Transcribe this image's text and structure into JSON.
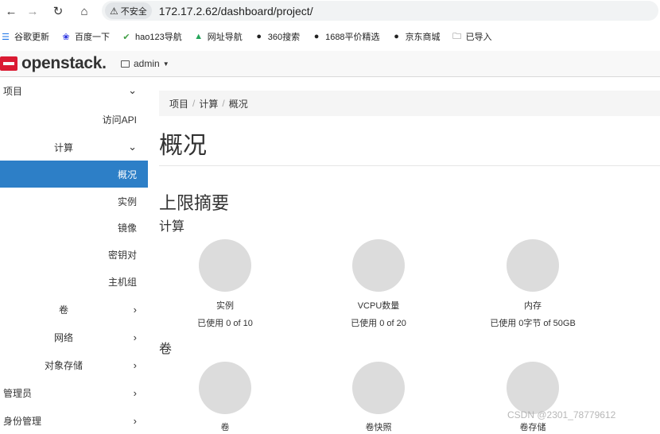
{
  "browser": {
    "security_label": "不安全",
    "url": "172.17.2.62/dashboard/project/",
    "bookmarks": [
      {
        "label": "谷歌更新",
        "icon": "wifi-icon"
      },
      {
        "label": "百度一下",
        "icon": "baidu-icon"
      },
      {
        "label": "hao123导航",
        "icon": "hao123-icon"
      },
      {
        "label": "网址导航",
        "icon": "nav-site-icon"
      },
      {
        "label": "360搜索",
        "icon": "globe-icon"
      },
      {
        "label": "1688平价精选",
        "icon": "globe-icon"
      },
      {
        "label": "京东商城",
        "icon": "globe-icon"
      },
      {
        "label": "已导入",
        "icon": "folder-icon"
      }
    ]
  },
  "header": {
    "logo": "openstack.",
    "project": "admin"
  },
  "sidebar": {
    "items": [
      {
        "label": "项目"
      },
      {
        "label": "访问API"
      },
      {
        "label": "计算"
      },
      {
        "label": "概况"
      },
      {
        "label": "实例"
      },
      {
        "label": "镜像"
      },
      {
        "label": "密钥对"
      },
      {
        "label": "主机组"
      },
      {
        "label": "卷"
      },
      {
        "label": "网络"
      },
      {
        "label": "对象存储"
      },
      {
        "label": "管理员"
      },
      {
        "label": "身份管理"
      }
    ]
  },
  "breadcrumb": [
    "项目",
    "计算",
    "概况"
  ],
  "page_title": "概况",
  "limits": {
    "heading": "上限摘要",
    "compute": {
      "heading": "计算",
      "charts": [
        {
          "label": "实例",
          "usage": "已使用 0 of 10",
          "used": 0,
          "total": 10
        },
        {
          "label": "VCPU数量",
          "usage": "已使用 0 of 20",
          "used": 0,
          "total": 20
        },
        {
          "label": "内存",
          "usage": "已使用 0字节 of 50GB",
          "used": 0,
          "total": 50
        }
      ]
    },
    "volume": {
      "heading": "卷",
      "charts": [
        {
          "label": "卷"
        },
        {
          "label": "卷快照"
        },
        {
          "label": "卷存储"
        }
      ]
    }
  },
  "watermark": "CSDN @2301_78779612",
  "colors": {
    "active": "#2d7fc7",
    "logo_red": "#da1a32",
    "pie": "#dcdcdc"
  }
}
